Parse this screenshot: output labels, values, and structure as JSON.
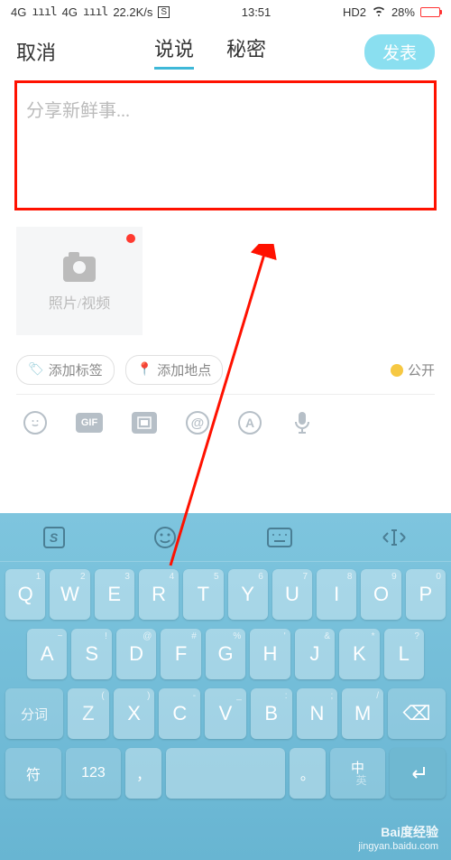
{
  "status": {
    "net1": "4G",
    "sig1": "ıııl",
    "net2": "4G",
    "sig2": "ıııl",
    "speed": "22.2K/s",
    "icon_s": "S",
    "time": "13:51",
    "hd": "HD2",
    "battery_pct": "28%"
  },
  "header": {
    "cancel": "取消",
    "tab_shuoshuo": "说说",
    "tab_secret": "秘密",
    "publish": "发表"
  },
  "compose": {
    "placeholder": "分享新鲜事..."
  },
  "media": {
    "label": "照片/视频"
  },
  "chips": {
    "add_tag": "添加标签",
    "add_location": "添加地点",
    "visibility": "公开"
  },
  "toolbar": {
    "gif": "GIF",
    "at": "@",
    "a": "A"
  },
  "keyboard": {
    "s_logo": "S",
    "row1": [
      {
        "main": "Q",
        "alt": "1"
      },
      {
        "main": "W",
        "alt": "2"
      },
      {
        "main": "E",
        "alt": "3"
      },
      {
        "main": "R",
        "alt": "4"
      },
      {
        "main": "T",
        "alt": "5"
      },
      {
        "main": "Y",
        "alt": "6"
      },
      {
        "main": "U",
        "alt": "7"
      },
      {
        "main": "I",
        "alt": "8"
      },
      {
        "main": "O",
        "alt": "9"
      },
      {
        "main": "P",
        "alt": "0"
      }
    ],
    "row2": [
      {
        "main": "A",
        "alt": "~"
      },
      {
        "main": "S",
        "alt": "!"
      },
      {
        "main": "D",
        "alt": "@"
      },
      {
        "main": "F",
        "alt": "#"
      },
      {
        "main": "G",
        "alt": "%"
      },
      {
        "main": "H",
        "alt": "'"
      },
      {
        "main": "J",
        "alt": "&"
      },
      {
        "main": "K",
        "alt": "*"
      },
      {
        "main": "L",
        "alt": "?"
      }
    ],
    "row3_shift": "分词",
    "row3": [
      {
        "main": "Z",
        "alt": "("
      },
      {
        "main": "X",
        "alt": ")"
      },
      {
        "main": "C",
        "alt": "-"
      },
      {
        "main": "V",
        "alt": "_"
      },
      {
        "main": "B",
        "alt": ":"
      },
      {
        "main": "N",
        "alt": ";"
      },
      {
        "main": "M",
        "alt": "/"
      }
    ],
    "row3_del": "⌫",
    "row4": {
      "sym": "符",
      "num": "123",
      "comma": "，",
      "space": "",
      "period": "。",
      "cn_top": "中",
      "cn_bot": "英",
      "enter": "↵"
    }
  },
  "watermark": {
    "brand": "Bai度经验",
    "url": "jingyan.baidu.com"
  }
}
